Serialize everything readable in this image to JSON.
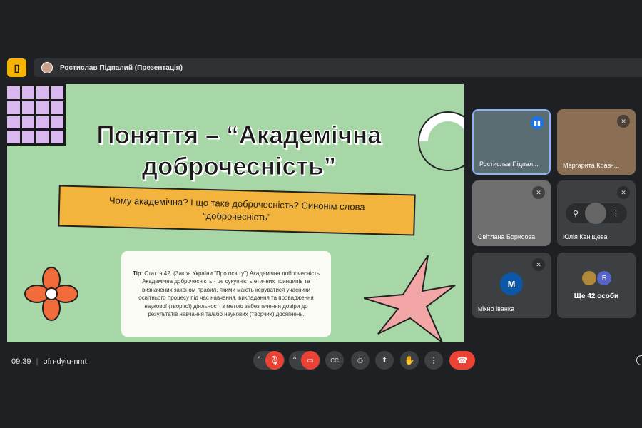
{
  "app": {
    "logo": "▯"
  },
  "presenter": {
    "label": "Ростислав Підпалий (Презентація)"
  },
  "slide": {
    "title": "Поняття – “Академічна доброчесність”",
    "question": "Чому академічна? І що таке доброчесність? Синонім слова “доброчесність”",
    "tip_label": "Tip",
    "tip_text": ": Стаття 42. (Закон України \"Про освіту\") Академічна доброчесність Академічна доброчесність - це сукупність етичних принципів та визначених законом правил, якими мають керуватися учасники освітнього процесу під час навчання, викладання та провадження наукової (творчої) діяльності з метою забезпечення довіри до результатів навчання та/або наукових (творчих) досягнень."
  },
  "participants": [
    {
      "name": "Ростислав Підпал...",
      "muted": false
    },
    {
      "name": "Маргарита Кравч...",
      "muted": true
    },
    {
      "name": "Світлана Борисова",
      "muted": true
    },
    {
      "name": "Юлія Каніщева",
      "muted": true
    },
    {
      "name": "міхно іванка",
      "initial": "М",
      "muted": true
    }
  ],
  "more": {
    "label": "Ще 42 особи",
    "initial": "Б"
  },
  "bottom": {
    "time": "09:39",
    "separator": "|",
    "meeting_code": "ofn-dyiu-nmt"
  },
  "colors": {
    "accent": "#8ab4f8",
    "danger": "#ea4335",
    "slide_bg": "#a7d7a6"
  }
}
